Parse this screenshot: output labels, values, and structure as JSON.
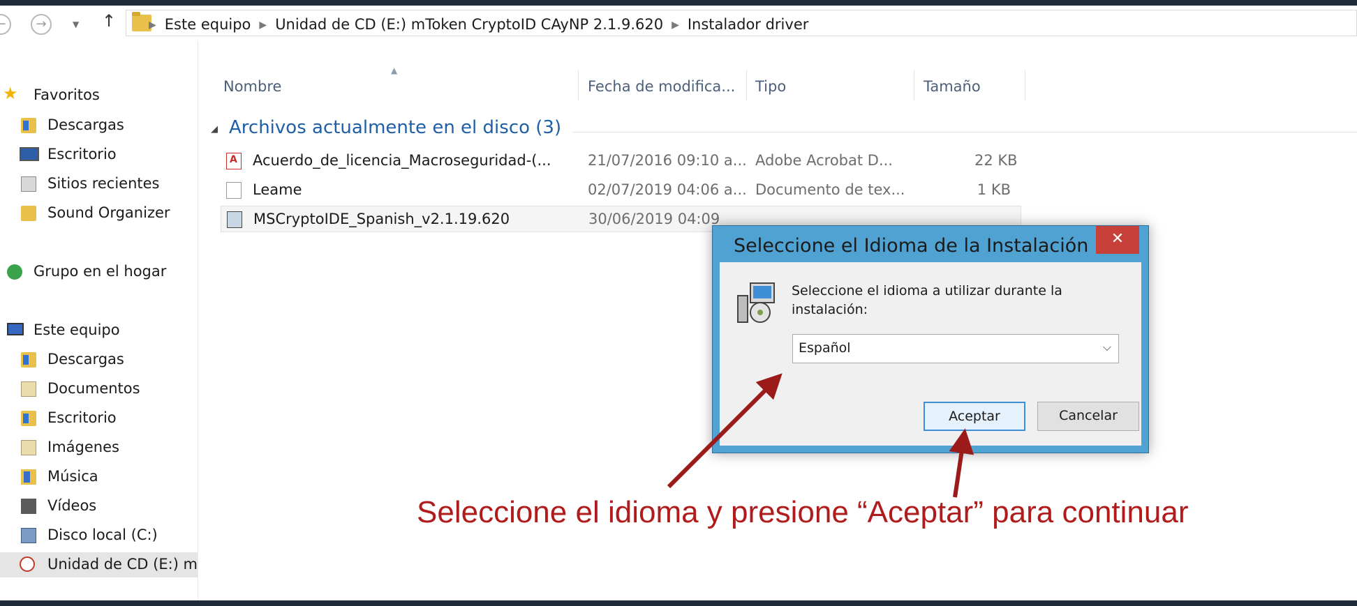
{
  "address_bar": {
    "crumbs": [
      "Este equipo",
      "Unidad de CD (E:) mToken CryptoID CAyNP 2.1.9.620",
      "Instalador driver"
    ]
  },
  "nav_pane": {
    "favorites_header": "Favoritos",
    "favorites": [
      "Descargas",
      "Escritorio",
      "Sitios recientes",
      "Sound Organizer"
    ],
    "homegroup": "Grupo en el hogar",
    "this_pc_header": "Este equipo",
    "this_pc_items": [
      "Descargas",
      "Documentos",
      "Escritorio",
      "Imágenes",
      "Música",
      "Vídeos",
      "Disco local (C:)",
      "Unidad de CD (E:) m"
    ]
  },
  "columns": {
    "name": "Nombre",
    "date": "Fecha de modifica...",
    "type": "Tipo",
    "size": "Tamaño"
  },
  "group": {
    "title": "Archivos actualmente en el disco (3)"
  },
  "files": [
    {
      "name": "Acuerdo_de_licencia_Macroseguridad-(...",
      "date": "21/07/2016 09:10 a...",
      "type": "Adobe Acrobat D...",
      "size": "22 KB",
      "icon": "pdf-icon"
    },
    {
      "name": "Leame",
      "date": "02/07/2019 04:06 a...",
      "type": "Documento de tex...",
      "size": "1 KB",
      "icon": "text-file-icon"
    },
    {
      "name": "MSCryptoIDE_Spanish_v2.1.19.620",
      "date": "30/06/2019 04:09",
      "type": "",
      "size": "",
      "icon": "installer-icon"
    }
  ],
  "dialog": {
    "title": "Seleccione el Idioma de la Instalación",
    "close": "✕",
    "message": "Seleccione el idioma a utilizar durante la instalación:",
    "language": "Español",
    "ok": "Aceptar",
    "cancel": "Cancelar"
  },
  "annotation": {
    "text": "Seleccione el idioma y presione “Aceptar” para continuar",
    "color": "#b01b1b"
  }
}
